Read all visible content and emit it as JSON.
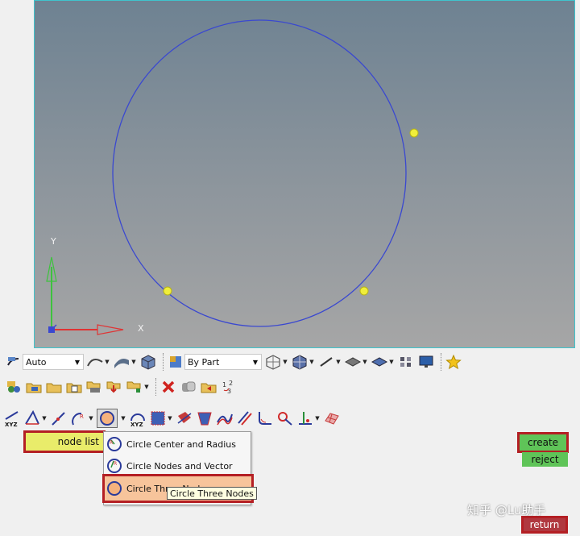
{
  "viewport": {
    "axis_y_label": "Y",
    "axis_x_label": "X",
    "circle_color": "#3a48d0",
    "node_color": "#f0ee3a"
  },
  "toolbar1": {
    "select_auto": "Auto",
    "select_by_part": "By Part"
  },
  "panel": {
    "node_list_label": "node list",
    "dropdown_options": [
      "Circle Center and Radius",
      "Circle Nodes and Vector",
      "Circle Three Nodes"
    ],
    "tooltip": "Circle Three Nodes",
    "create_label": "create",
    "reject_label": "reject",
    "return_label": "return"
  },
  "watermark": "知乎 @Lu助手",
  "colors": {
    "highlight_red": "#b41f24",
    "button_green": "#5fc458",
    "button_return": "#b0383f",
    "node_list_yellow": "#e9ec6a"
  }
}
